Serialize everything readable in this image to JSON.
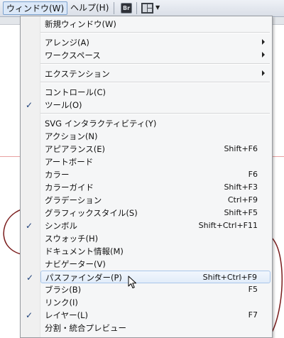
{
  "menubar": {
    "items": [
      {
        "label": "ウィンドウ(W)",
        "active": true
      },
      {
        "label": "ヘルプ(H)",
        "active": false
      }
    ],
    "br_icon_text": "Br",
    "layout_icon": "workspace-layout-icon",
    "dropdown_icon": "dropdown-triangle-icon"
  },
  "menu": {
    "items": [
      {
        "label": "新規ウィンドウ(W)",
        "shortcut": "",
        "submenu": false,
        "checked": false
      },
      {
        "label": "アレンジ(A)",
        "shortcut": "",
        "submenu": true,
        "checked": false
      },
      {
        "label": "ワークスペース",
        "shortcut": "",
        "submenu": true,
        "checked": false
      },
      {
        "label": "エクステンション",
        "shortcut": "",
        "submenu": true,
        "checked": false
      },
      {
        "label": "コントロール(C)",
        "shortcut": "",
        "submenu": false,
        "checked": false
      },
      {
        "label": "ツール(O)",
        "shortcut": "",
        "submenu": false,
        "checked": true
      },
      {
        "label": "SVG インタラクティビティ(Y)",
        "shortcut": "",
        "submenu": false,
        "checked": false
      },
      {
        "label": "アクション(N)",
        "shortcut": "",
        "submenu": false,
        "checked": false
      },
      {
        "label": "アピアランス(E)",
        "shortcut": "Shift+F6",
        "submenu": false,
        "checked": false
      },
      {
        "label": "アートボード",
        "shortcut": "",
        "submenu": false,
        "checked": false
      },
      {
        "label": "カラー",
        "shortcut": "F6",
        "submenu": false,
        "checked": false
      },
      {
        "label": "カラーガイド",
        "shortcut": "Shift+F3",
        "submenu": false,
        "checked": false
      },
      {
        "label": "グラデーション",
        "shortcut": "Ctrl+F9",
        "submenu": false,
        "checked": false
      },
      {
        "label": "グラフィックスタイル(S)",
        "shortcut": "Shift+F5",
        "submenu": false,
        "checked": false
      },
      {
        "label": "シンボル",
        "shortcut": "Shift+Ctrl+F11",
        "submenu": false,
        "checked": true
      },
      {
        "label": "スウォッチ(H)",
        "shortcut": "",
        "submenu": false,
        "checked": false
      },
      {
        "label": "ドキュメント情報(M)",
        "shortcut": "",
        "submenu": false,
        "checked": false
      },
      {
        "label": "ナビゲーター(V)",
        "shortcut": "",
        "submenu": false,
        "checked": false
      },
      {
        "label": "パスファインダー(P)",
        "shortcut": "Shift+Ctrl+F9",
        "submenu": false,
        "checked": true,
        "hovered": true
      },
      {
        "label": "ブラシ(B)",
        "shortcut": "F5",
        "submenu": false,
        "checked": false
      },
      {
        "label": "リンク(I)",
        "shortcut": "",
        "submenu": false,
        "checked": false
      },
      {
        "label": "レイヤー(L)",
        "shortcut": "F7",
        "submenu": false,
        "checked": true
      },
      {
        "label": "分割・統合プレビュー",
        "shortcut": "",
        "submenu": false,
        "checked": false
      }
    ],
    "check_glyph": "✓"
  },
  "colors": {
    "menu_bg": "#f5f6f7",
    "hover_border": "#a8c6ea",
    "check_color": "#1d3f78"
  }
}
